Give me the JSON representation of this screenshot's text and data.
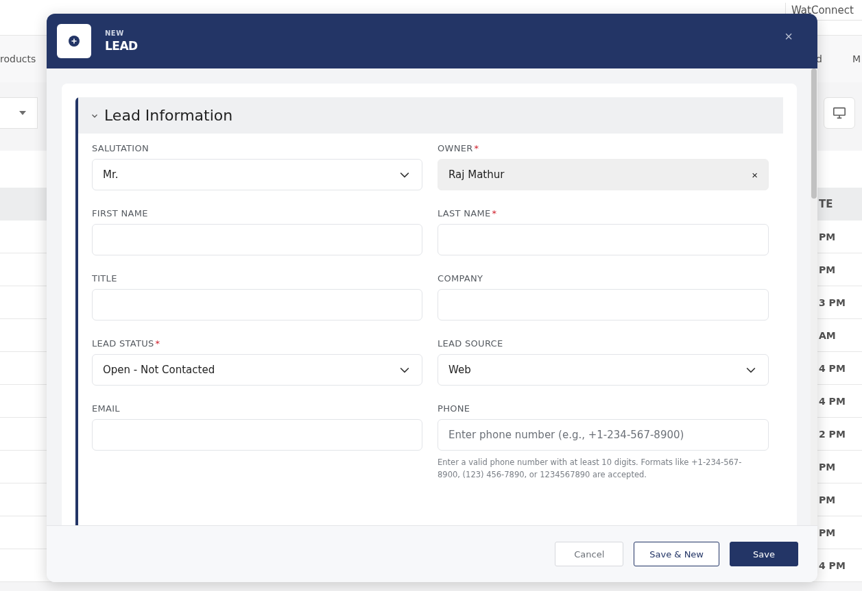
{
  "background": {
    "app_name": "WatConnect",
    "nav_items": [
      "roducts",
      "d",
      "M"
    ],
    "table": {
      "column_header": "TE",
      "rows": [
        "PM",
        "PM",
        "3 PM",
        "AM",
        "4 PM",
        "4 PM",
        "2 PM",
        "PM",
        "PM",
        "PM",
        "4 PM"
      ]
    }
  },
  "modal": {
    "overline": "NEW",
    "title": "LEAD",
    "close_label": "×",
    "section": {
      "title": "Lead Information",
      "expanded": true,
      "fields": [
        {
          "label": "SALUTATION",
          "kind": "select",
          "value": "Mr."
        },
        {
          "label": "OWNER",
          "kind": "lookup",
          "required_mark": "*",
          "value": "Raj Mathur",
          "clear_label": "×"
        },
        {
          "label": "FIRST NAME",
          "kind": "text"
        },
        {
          "label": "LAST NAME",
          "kind": "text",
          "required_mark": "*"
        },
        {
          "label": "TITLE",
          "kind": "text"
        },
        {
          "label": "COMPANY",
          "kind": "text"
        },
        {
          "label": "LEAD STATUS",
          "kind": "select",
          "required_mark": "*",
          "value": "Open - Not Contacted"
        },
        {
          "label": "LEAD SOURCE",
          "kind": "select",
          "value": "Web"
        },
        {
          "label": "EMAIL",
          "kind": "text"
        },
        {
          "label": "PHONE",
          "kind": "text",
          "placeholder": "Enter phone number (e.g., +1-234-567-8900)",
          "help": "Enter a valid phone number with at least 10 digits. Formats like +1-234-567-8900, (123) 456-7890, or 1234567890 are accepted."
        }
      ]
    },
    "buttons": [
      {
        "label": "Cancel",
        "kind": "cancel"
      },
      {
        "label": "Save & New",
        "kind": "secondary"
      },
      {
        "label": "Save",
        "kind": "primary"
      }
    ]
  }
}
